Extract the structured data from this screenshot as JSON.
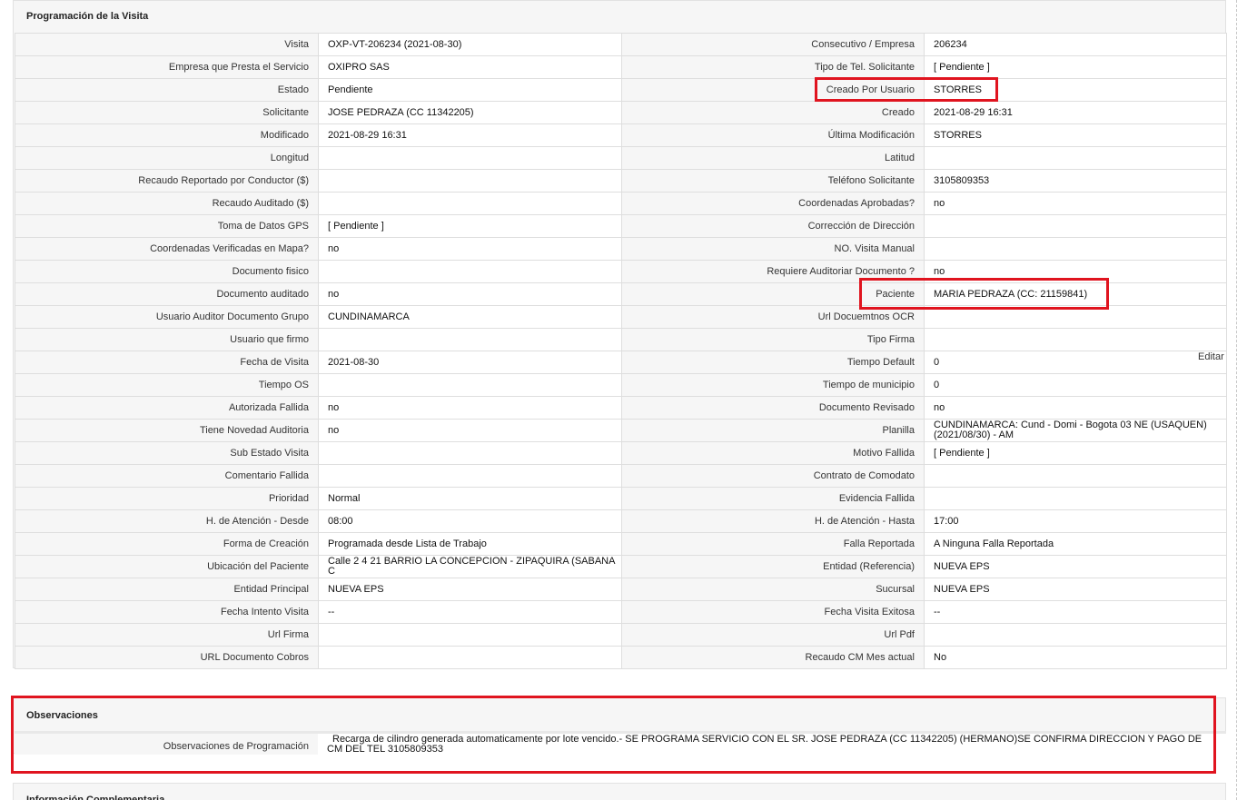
{
  "sections": {
    "programacion": {
      "title": "Programación de la Visita"
    },
    "observaciones": {
      "title": "Observaciones",
      "label": "Observaciones de Programación",
      "value": "Recarga de cilindro generada automaticamente por lote vencido.- SE PROGRAMA SERVICIO CON EL SR. JOSE PEDRAZA (CC 11342205) (HERMANO)SE CONFIRMA DIRECCION Y PAGO DE CM DEL TEL 3105809353"
    },
    "complementaria": {
      "title": "Información Complementaria"
    }
  },
  "edit_label": "Editar",
  "rows": [
    {
      "l1": "Visita",
      "v1": "OXP-VT-206234 (2021-08-30)",
      "l2": "Consecutivo / Empresa",
      "v2": "206234"
    },
    {
      "l1": "Empresa que Presta el Servicio",
      "v1": "OXIPRO SAS",
      "l2": "Tipo de Tel. Solicitante",
      "v2": "[ Pendiente ]"
    },
    {
      "l1": "Estado",
      "v1": "Pendiente",
      "l2": "Creado Por Usuario",
      "v2": "STORRES"
    },
    {
      "l1": "Solicitante",
      "v1": "JOSE PEDRAZA (CC 11342205)",
      "l2": "Creado",
      "v2": "2021-08-29 16:31"
    },
    {
      "l1": "Modificado",
      "v1": "2021-08-29 16:31",
      "l2": "Última Modificación",
      "v2": " STORRES"
    },
    {
      "l1": "Longitud",
      "v1": "",
      "l2": "Latitud",
      "v2": ""
    },
    {
      "l1": "Recaudo Reportado por Conductor ($)",
      "v1": "",
      "l2": "Teléfono Solicitante",
      "v2": "3105809353"
    },
    {
      "l1": "Recaudo Auditado ($)",
      "v1": "",
      "l2": "Coordenadas Aprobadas?",
      "v2": " no"
    },
    {
      "l1": "Toma de Datos GPS",
      "v1": "[ Pendiente ]",
      "l2": "Corrección de Dirección",
      "v2": ""
    },
    {
      "l1": "Coordenadas Verificadas en Mapa?",
      "v1": " no",
      "l2": "NO. Visita Manual",
      "v2": ""
    },
    {
      "l1": "Documento fisico",
      "v1": "",
      "l2": "Requiere Auditoriar Documento ?",
      "v2": " no"
    },
    {
      "l1": "Documento auditado",
      "v1": " no",
      "l2": "Paciente",
      "v2": "MARIA PEDRAZA (CC: 21159841)"
    },
    {
      "l1": "Usuario Auditor Documento Grupo",
      "v1": "CUNDINAMARCA",
      "l2": "Url Docuemtnos OCR",
      "v2": ""
    },
    {
      "l1": "Usuario que firmo",
      "v1": "",
      "l2": "Tipo Firma",
      "v2": ""
    },
    {
      "l1": "Fecha de Visita",
      "v1": " 2021-08-30",
      "l2": "Tiempo Default",
      "v2": "0"
    },
    {
      "l1": "Tiempo OS",
      "v1": "",
      "l2": "Tiempo de municipio",
      "v2": "0"
    },
    {
      "l1": "Autorizada Fallida",
      "v1": " no",
      "l2": "Documento Revisado",
      "v2": " no"
    },
    {
      "l1": "Tiene Novedad Auditoria",
      "v1": " no",
      "l2": "Planilla",
      "v2": "CUNDINAMARCA: Cund - Domi - Bogota 03 NE (USAQUEN) (2021/08/30) - AM"
    },
    {
      "l1": "Sub Estado Visita",
      "v1": "",
      "l2": "Motivo Fallida",
      "v2": "[ Pendiente ]"
    },
    {
      "l1": "Comentario Fallida",
      "v1": "",
      "l2": "Contrato de Comodato",
      "v2": ""
    },
    {
      "l1": "Prioridad",
      "v1": "Normal",
      "l2": "Evidencia Fallida",
      "v2": ""
    },
    {
      "l1": "H. de Atención - Desde",
      "v1": "08:00",
      "l2": "H. de Atención - Hasta",
      "v2": "17:00"
    },
    {
      "l1": "Forma de Creación",
      "v1": "Programada desde Lista de Trabajo",
      "l2": "Falla Reportada",
      "v2": "A Ninguna Falla Reportada"
    },
    {
      "l1": "Ubicación del Paciente",
      "v1": "Calle 2 4 21 BARRIO LA CONCEPCION - ZIPAQUIRA (SABANA C",
      "l2": "Entidad (Referencia)",
      "v2": "NUEVA EPS"
    },
    {
      "l1": "Entidad Principal",
      "v1": "NUEVA EPS",
      "l2": "Sucursal",
      "v2": "NUEVA EPS"
    },
    {
      "l1": "Fecha Intento Visita",
      "v1": " --",
      "l2": "Fecha Visita Exitosa",
      "v2": " --"
    },
    {
      "l1": "Url Firma",
      "v1": "",
      "l2": "Url Pdf",
      "v2": ""
    },
    {
      "l1": "URL Documento Cobros",
      "v1": "",
      "l2": "Recaudo CM Mes actual",
      "v2": "No"
    }
  ]
}
